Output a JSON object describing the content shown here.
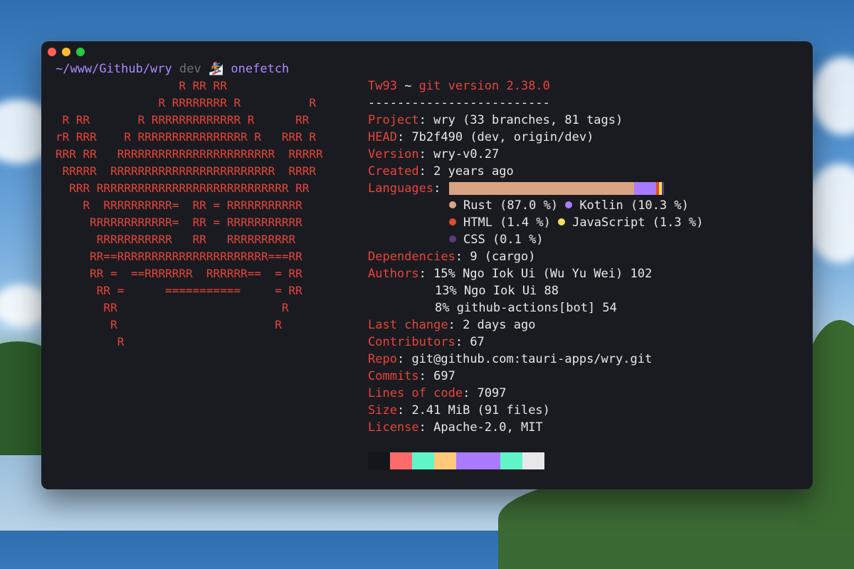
{
  "window": {
    "prompt": {
      "path": "~/www/Github/wry",
      "branch": "dev",
      "icon": "snowboarder-icon",
      "command": "onefetch"
    },
    "logo_lines": [
      "                  R RR RR",
      "               R RRRRRRRR R          R",
      " R RR       R RRRRRRRRRRRRR R      RR",
      "rR RRR    R RRRRRRRRRRRRRRRR R   RRR R",
      "RRR RR   RRRRRRRRRRRRRRRRRRRRRRR  RRRRR",
      " RRRRR  RRRRRRRRRRRRRRRRRRRRRRRR  RRRR",
      "  RRR RRRRRRRRRRRRRRRRRRRRRRRRRRRR RR",
      "    R  RRRRRRRRRR=  RR = RRRRRRRRRRR",
      "     RRRRRRRRRRRR=  RR = RRRRRRRRRRR",
      "      RRRRRRRRRRR   RR   RRRRRRRRRR",
      "     RR==RRRRRRRRRRRRRRRRRRRRRR===RR",
      "     RR =  ==RRRRRRR  RRRRRR==  = RR",
      "      RR =      ===========     = RR",
      "       RR                        R",
      "        R                       R",
      "         R"
    ],
    "header": {
      "user": "Tw93",
      "separator": " ~ ",
      "git_version": "git version 2.38.0",
      "divider": "-------------------------"
    },
    "fields": {
      "project": {
        "key": "Project",
        "value": "wry (33 branches, 81 tags)"
      },
      "head": {
        "key": "HEAD",
        "value": "7b2f490 (dev, origin/dev)"
      },
      "version": {
        "key": "Version",
        "value": "wry-v0.27"
      },
      "created": {
        "key": "Created",
        "value": "2 years ago"
      },
      "languages_key": "Languages",
      "dependencies": {
        "key": "Dependencies",
        "value": "9 (cargo)"
      },
      "authors_key": "Authors",
      "last_change": {
        "key": "Last change",
        "value": "2 days ago"
      },
      "contributors": {
        "key": "Contributors",
        "value": "67"
      },
      "repo": {
        "key": "Repo",
        "value": "git@github.com:tauri-apps/wry.git"
      },
      "commits": {
        "key": "Commits",
        "value": "697"
      },
      "lines_of_code": {
        "key": "Lines of code",
        "value": "7097"
      },
      "size": {
        "key": "Size",
        "value": "2.41 MiB (91 files)"
      },
      "license": {
        "key": "License",
        "value": "Apache-2.0, MIT"
      }
    },
    "languages": [
      {
        "name": "Rust",
        "label": "Rust (87.0 %)",
        "percent": 87.0,
        "color": "#d9a484"
      },
      {
        "name": "Kotlin",
        "label": "Kotlin (10.3 %)",
        "percent": 10.3,
        "color": "#a97bff"
      },
      {
        "name": "HTML",
        "label": "HTML (1.4 %)",
        "percent": 1.4,
        "color": "#e34c26"
      },
      {
        "name": "JavaScript",
        "label": "JavaScript (1.3 %)",
        "percent": 1.3,
        "color": "#f1e05a"
      },
      {
        "name": "CSS",
        "label": "CSS (0.1 %)",
        "percent": 0.1,
        "color": "#563d7c"
      }
    ],
    "authors": [
      "15% Ngo Iok Ui (Wu Yu Wei) 102",
      "13% Ngo Iok Ui 88",
      "8% github-actions[bot] 54"
    ],
    "palette": [
      "#15161c",
      "#ff6b6b",
      "#5ff5c9",
      "#ffc97a",
      "#a97bff",
      "#a97bff",
      "#5ff5c9",
      "#e8e8ea"
    ]
  }
}
